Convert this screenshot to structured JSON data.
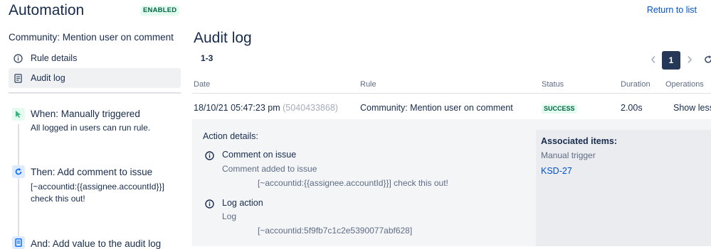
{
  "header": {
    "title": "Automation",
    "status_badge": "ENABLED",
    "return_link": "Return to list"
  },
  "sidebar": {
    "rule_name": "Community: Mention user on comment",
    "items": [
      {
        "label": "Rule details",
        "icon": "info-icon"
      },
      {
        "label": "Audit log",
        "icon": "document-icon"
      }
    ],
    "steps": [
      {
        "title": "When: Manually triggered",
        "lines": [
          "All logged in users can run rule."
        ],
        "icon": "cursor-icon",
        "color": "#36b37e"
      },
      {
        "title": "Then: Add comment to issue",
        "lines": [
          "[~accountid:{{assignee.accountId}}]",
          "check this out!"
        ],
        "icon": "refresh-icon",
        "color": "#0065ff"
      },
      {
        "title": "And: Add value to the audit log",
        "lines": [],
        "icon": "document-icon",
        "color": "#0065ff"
      }
    ]
  },
  "main": {
    "title": "Audit log",
    "range": "1-3",
    "pagination": {
      "current_page": "1"
    },
    "columns": [
      "Date",
      "Rule",
      "Status",
      "Duration",
      "Operations"
    ],
    "row": {
      "date": "18/10/21 05:47:23 pm",
      "id": "(5040433868)",
      "rule": "Community: Mention user on comment",
      "status": "SUCCESS",
      "duration": "2.00s",
      "operation": "Show less"
    },
    "details": {
      "heading": "Action details:",
      "actions": [
        {
          "title": "Comment on issue",
          "subtitle": "Comment added to issue",
          "detail": "[~accountid:{{assignee.accountId}}] check this out!"
        },
        {
          "title": "Log action",
          "subtitle": "Log",
          "detail": "[~accountid:5f9fb7c1c2e5390077abf628]"
        }
      ],
      "associated": {
        "heading": "Associated items:",
        "trigger": "Manual trigger",
        "issue_link": "KSD-27"
      }
    }
  },
  "colors": {
    "accent": "#0052cc",
    "success_bg": "#e3fcef",
    "success_text": "#006644",
    "pager_active": "#253858"
  }
}
